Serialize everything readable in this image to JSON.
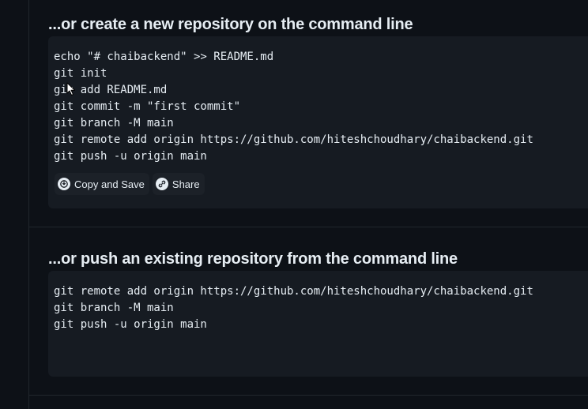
{
  "section_new": {
    "heading": "...or create a new repository on the command line",
    "lines": [
      "echo \"# chaibackend\" >> README.md",
      "git init",
      "git add README.md",
      "git commit -m \"first commit\"",
      "git branch -M main",
      "git remote add origin https://github.com/hiteshchoudhary/chaibackend.git",
      "git push -u origin main"
    ],
    "copy_save_label": "Copy and Save",
    "copy_save_icon": "copy-save-icon",
    "share_label": "Share",
    "share_icon": "link-icon"
  },
  "section_existing": {
    "heading": "...or push an existing repository from the command line",
    "lines": [
      "git remote add origin https://github.com/hiteshchoudhary/chaibackend.git",
      "git branch -M main",
      "git push -u origin main"
    ]
  },
  "colors": {
    "page_background": "#0d1117",
    "code_background": "#161b22",
    "text": "#e6edf3",
    "divider": "#21262d"
  }
}
